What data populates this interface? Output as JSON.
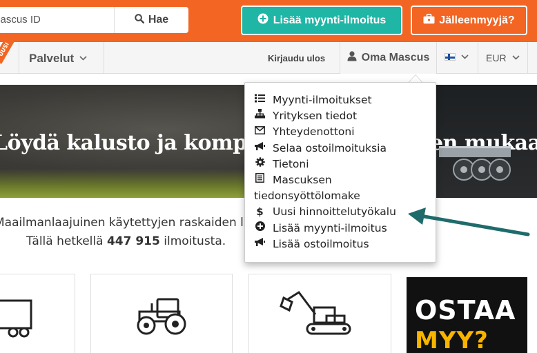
{
  "header": {
    "search_value": "Mascus ID",
    "search_button": "Hae",
    "add_listing_button": "Lisää myynti-ilmoitus",
    "dealer_button": "Jälleenmyyjä?"
  },
  "nav": {
    "ribbon": "UUSI",
    "services": "Palvelut",
    "logout": "Kirjaudu ulos",
    "my_mascus": "Oma Mascus",
    "currency": "EUR"
  },
  "hero": {
    "title": "Löydä kalusto ja komponenteet toiveiden mukaan"
  },
  "intro": {
    "line1": "Maailmanlaajuinen käytettyjen raskaiden laitteiden markkinapaikka.",
    "line2_prefix": "Tällä hetkellä ",
    "count": "447 915",
    "line2_suffix": " ilmoitusta."
  },
  "dropdown": {
    "items": [
      {
        "label": "Myynti-ilmoitukset",
        "icon": "list-icon"
      },
      {
        "label": "Yrityksen tiedot",
        "icon": "sitemap-icon"
      },
      {
        "label": "Yhteydenottoni",
        "icon": "envelope-icon"
      },
      {
        "label": "Selaa ostoilmoituksia",
        "icon": "bullhorn-icon"
      },
      {
        "label": "Tietoni",
        "icon": "gear-icon"
      },
      {
        "label": "Mascuksen",
        "label_line2": "tiedonsyöttölomake",
        "icon": "form-icon"
      },
      {
        "label": "Uusi hinnoittelutyökalu",
        "icon": "dollar-icon"
      },
      {
        "label": "Lisää myynti-ilmoitus",
        "icon": "plus-circle-icon"
      },
      {
        "label": "Lisää ostoilmoitus",
        "icon": "bullhorn-icon"
      }
    ]
  },
  "promo": {
    "line1": "OSTAA",
    "line2": "MYY?"
  },
  "colors": {
    "brand_orange": "#f26522",
    "teal_button": "#1fb6a6",
    "annotation_arrow": "#1f6b6b"
  }
}
